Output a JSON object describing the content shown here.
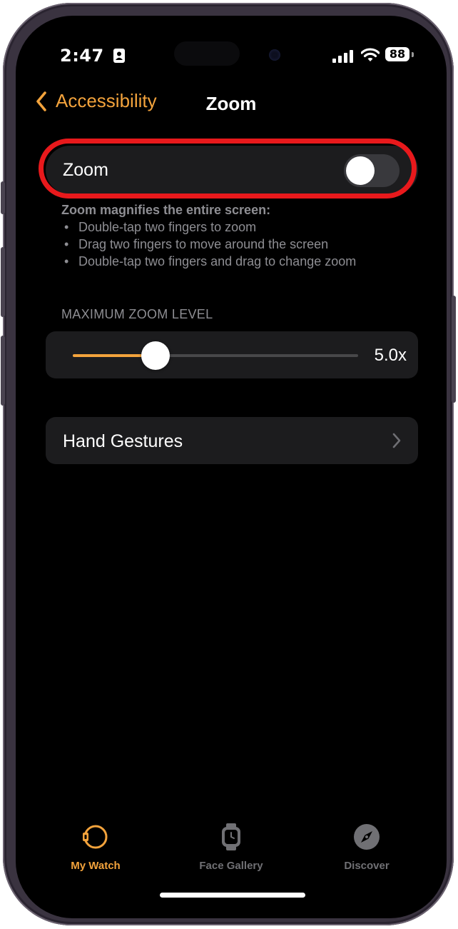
{
  "status_bar": {
    "time": "2:47",
    "battery": "88"
  },
  "nav": {
    "back_label": "Accessibility",
    "title": "Zoom"
  },
  "zoom_toggle": {
    "label": "Zoom",
    "enabled": false
  },
  "description": {
    "heading": "Zoom magnifies the entire screen:",
    "bullets": [
      "Double-tap two fingers to zoom",
      "Drag two fingers to move around the screen",
      "Double-tap two fingers and drag to change zoom"
    ]
  },
  "max_zoom": {
    "header": "MAXIMUM ZOOM LEVEL",
    "value_label": "5.0x",
    "fraction": 0.29
  },
  "hand_gestures": {
    "label": "Hand Gestures"
  },
  "tabs": [
    {
      "label": "My Watch",
      "icon": "watch-icon",
      "active": true
    },
    {
      "label": "Face Gallery",
      "icon": "watch-face-icon",
      "active": false
    },
    {
      "label": "Discover",
      "icon": "compass-icon",
      "active": false
    }
  ],
  "colors": {
    "accent": "#f3a33c",
    "highlight_ring": "#e8191c",
    "cell_bg": "#1c1c1e",
    "secondary_text": "#8e8e93"
  }
}
